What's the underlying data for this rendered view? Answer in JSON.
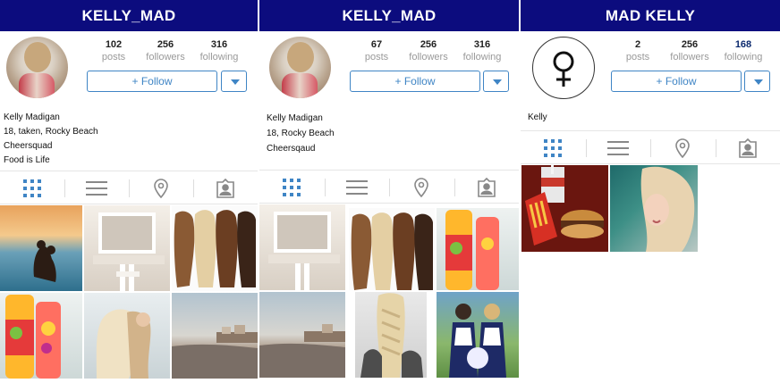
{
  "accent_color": "#3f85c5",
  "titlebar_color": "#0c0c7e",
  "panels": [
    {
      "title": "KELLY_MAD",
      "stats": [
        {
          "num": "102",
          "label": "posts"
        },
        {
          "num": "256",
          "label": "followers"
        },
        {
          "num": "316",
          "label": "following"
        }
      ],
      "follow_label": "+ Follow",
      "bio": [
        "Kelly Madigan",
        "18, taken, Rocky Beach",
        "Cheersquad",
        "Food is Life"
      ],
      "tabs": [
        "grid-icon",
        "list-icon",
        "location-pin-icon",
        "tagged-person-icon"
      ],
      "photos": [
        "beach-sunset-couple-photo",
        "vanity-mirror-photo",
        "hair-group-photo",
        "fruit-water-bottle-photo",
        "hug-photo",
        "beach-town-photo"
      ]
    },
    {
      "title": "KELLY_MAD",
      "stats": [
        {
          "num": "67",
          "label": "posts"
        },
        {
          "num": "256",
          "label": "followers"
        },
        {
          "num": "316",
          "label": "following"
        }
      ],
      "follow_label": "+ Follow",
      "bio": [
        "Kelly Madigan",
        "18, Rocky Beach",
        "Cheersqaud"
      ],
      "tabs": [
        "grid-icon",
        "list-icon",
        "location-pin-icon",
        "tagged-person-icon"
      ],
      "photos": [
        "vanity-mirror-photo",
        "hair-group-photo",
        "fruit-water-bottle-photo",
        "beach-town-photo",
        "braid-photo",
        "cheerleaders-photo"
      ]
    },
    {
      "title": "MAD KELLY",
      "stats": [
        {
          "num": "2",
          "label": "posts"
        },
        {
          "num": "256",
          "label": "followers"
        },
        {
          "num": "168",
          "label": "following"
        }
      ],
      "follow_label": "+ Follow",
      "bio": [
        "Kelly"
      ],
      "tabs": [
        "grid-icon",
        "list-icon",
        "location-pin-icon",
        "tagged-person-icon"
      ],
      "photos": [
        "fast-food-photo",
        "blonde-portrait-photo"
      ]
    }
  ]
}
